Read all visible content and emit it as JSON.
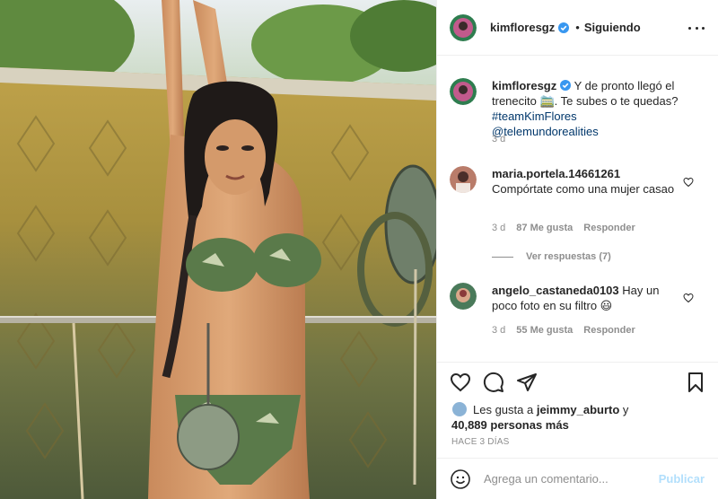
{
  "post": {
    "image_alt": "Fotografía de la publicación",
    "accent": "#0095f6"
  },
  "header": {
    "username": "kimfloresgz",
    "verified_icon": "verified-badge-icon",
    "separator": "•",
    "following_label": "Siguiendo",
    "more_icon": "ellipsis-icon"
  },
  "caption": {
    "username": "kimfloresgz",
    "text": " Y de pronto llegó el trenecito 🚞. Te subes o te quedas? ",
    "hashtag": "#teamKimFlores",
    "mention": " @telemundorealities",
    "time": "3 d"
  },
  "comments": [
    {
      "username": "maria.portela.14661261",
      "text": " Compórtate como una mujer casao",
      "time": "3 d",
      "likes": "87 Me gusta",
      "reply_label": "Responder"
    },
    {
      "username": "angelo_castaneda0103",
      "text": " Hay un poco foto en su filtro 😃",
      "time": "3 d",
      "likes": "55 Me gusta",
      "reply_label": "Responder"
    }
  ],
  "view_replies": "Ver respuestas (7)",
  "likes": {
    "prefix": "Les gusta a ",
    "user": "jeimmy_aburto",
    "middle": " y",
    "count": "40,889 personas más"
  },
  "timestamp": "HACE 3 DÍAS",
  "add_comment": {
    "placeholder": "Agrega un comentario...",
    "publish_label": "Publicar"
  },
  "colors": {
    "text": "#262626",
    "muted": "#8e8e8e",
    "link": "#00376b",
    "publish_disabled": "#b2dffc",
    "verified": "#3897f0"
  }
}
